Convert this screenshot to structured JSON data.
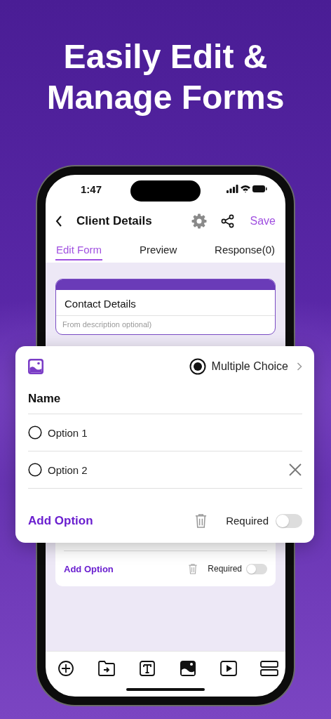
{
  "headline": [
    "Easily Edit &",
    "Manage Forms"
  ],
  "status_bar": {
    "time": "1:47"
  },
  "nav": {
    "title": "Client Details",
    "save": "Save"
  },
  "tabs": [
    {
      "label": "Edit Form",
      "selected": true
    },
    {
      "label": "Preview",
      "selected": false
    },
    {
      "label": "Response(0)",
      "selected": false
    }
  ],
  "form_header": {
    "title": "Contact Details",
    "description_placeholder": "From description optional)"
  },
  "back_question": {
    "add_option": "Add Option",
    "required_label": "Required",
    "required": false
  },
  "question_popup": {
    "type_label": "Multiple Choice",
    "question": "Name",
    "options": [
      {
        "label": "Option 1",
        "removable": false
      },
      {
        "label": "Option 2",
        "removable": true
      }
    ],
    "add_option": "Add Option",
    "required_label": "Required",
    "required": false
  },
  "toolbar": [
    {
      "kind": "add"
    },
    {
      "kind": "folder"
    },
    {
      "kind": "text"
    },
    {
      "kind": "image"
    },
    {
      "kind": "video"
    },
    {
      "kind": "layout"
    }
  ]
}
